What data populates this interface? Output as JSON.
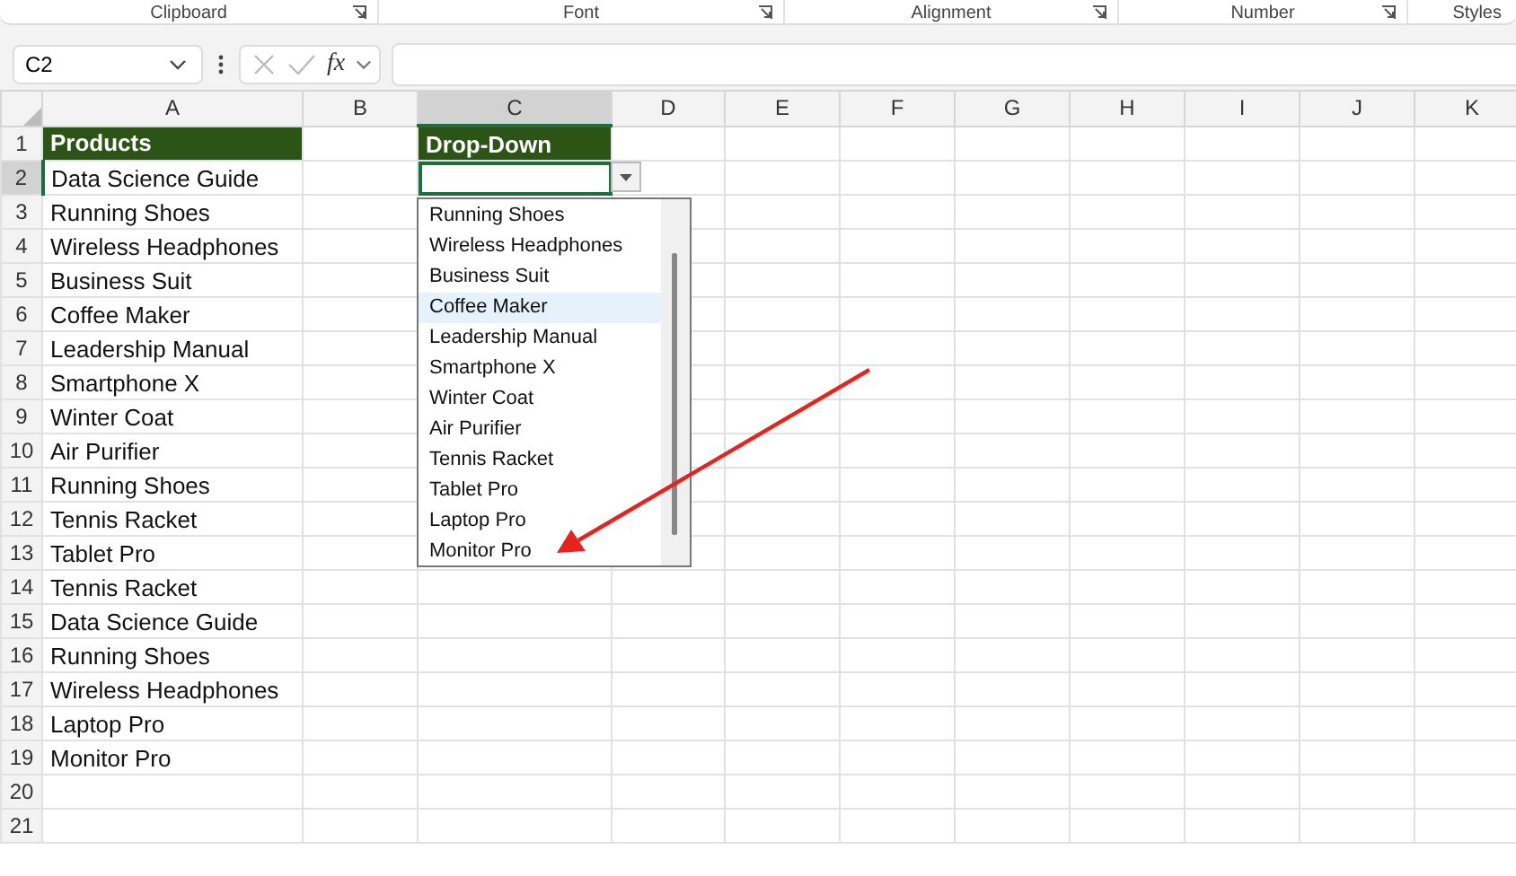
{
  "ribbon_groups": [
    {
      "label": "Clipboard",
      "launcher": true
    },
    {
      "label": "Font",
      "launcher": true
    },
    {
      "label": "Alignment",
      "launcher": true
    },
    {
      "label": "Number",
      "launcher": true
    },
    {
      "label": "Styles",
      "launcher": false
    }
  ],
  "formula_bar": {
    "name_box": "C2",
    "function_label": "fx"
  },
  "columns": [
    {
      "label": "A",
      "selected": false
    },
    {
      "label": "B",
      "selected": false
    },
    {
      "label": "C",
      "selected": true
    },
    {
      "label": "D",
      "selected": false
    },
    {
      "label": "E",
      "selected": false
    },
    {
      "label": "F",
      "selected": false
    },
    {
      "label": "G",
      "selected": false
    },
    {
      "label": "H",
      "selected": false
    },
    {
      "label": "I",
      "selected": false
    },
    {
      "label": "J",
      "selected": false
    },
    {
      "label": "K",
      "selected": false
    }
  ],
  "rows": [
    {
      "number": "1",
      "selected": false,
      "kind": "header",
      "a": "Products",
      "c": "Drop-Down"
    },
    {
      "number": "2",
      "selected": true,
      "kind": "data",
      "a": "Data Science Guide"
    },
    {
      "number": "3",
      "selected": false,
      "kind": "data",
      "a": "Running Shoes"
    },
    {
      "number": "4",
      "selected": false,
      "kind": "data",
      "a": "Wireless Headphones"
    },
    {
      "number": "5",
      "selected": false,
      "kind": "data",
      "a": "Business Suit"
    },
    {
      "number": "6",
      "selected": false,
      "kind": "data",
      "a": "Coffee Maker"
    },
    {
      "number": "7",
      "selected": false,
      "kind": "data",
      "a": "Leadership Manual"
    },
    {
      "number": "8",
      "selected": false,
      "kind": "data",
      "a": "Smartphone X"
    },
    {
      "number": "9",
      "selected": false,
      "kind": "data",
      "a": "Winter Coat"
    },
    {
      "number": "10",
      "selected": false,
      "kind": "data",
      "a": "Air Purifier"
    },
    {
      "number": "11",
      "selected": false,
      "kind": "data",
      "a": "Running Shoes"
    },
    {
      "number": "12",
      "selected": false,
      "kind": "data",
      "a": "Tennis Racket"
    },
    {
      "number": "13",
      "selected": false,
      "kind": "data",
      "a": "Tablet Pro"
    },
    {
      "number": "14",
      "selected": false,
      "kind": "data",
      "a": "Tennis Racket"
    },
    {
      "number": "15",
      "selected": false,
      "kind": "data",
      "a": "Data Science Guide"
    },
    {
      "number": "16",
      "selected": false,
      "kind": "data",
      "a": "Running Shoes"
    },
    {
      "number": "17",
      "selected": false,
      "kind": "data",
      "a": "Wireless Headphones"
    },
    {
      "number": "18",
      "selected": false,
      "kind": "data",
      "a": "Laptop Pro"
    },
    {
      "number": "19",
      "selected": false,
      "kind": "data",
      "a": "Monitor Pro"
    },
    {
      "number": "20",
      "selected": false,
      "kind": "data"
    },
    {
      "number": "21",
      "selected": false,
      "kind": "data"
    }
  ],
  "dropdown_list": [
    {
      "label": "Running Shoes",
      "selected": false
    },
    {
      "label": "Wireless Headphones",
      "selected": false
    },
    {
      "label": "Business Suit",
      "selected": false
    },
    {
      "label": "Coffee Maker",
      "selected": true
    },
    {
      "label": "Leadership Manual",
      "selected": false
    },
    {
      "label": "Smartphone X",
      "selected": false
    },
    {
      "label": "Winter Coat",
      "selected": false
    },
    {
      "label": "Air Purifier",
      "selected": false
    },
    {
      "label": "Tennis Racket",
      "selected": false
    },
    {
      "label": "Tablet Pro",
      "selected": false
    },
    {
      "label": "Laptop Pro",
      "selected": false
    },
    {
      "label": "Monitor Pro",
      "selected": false
    }
  ]
}
